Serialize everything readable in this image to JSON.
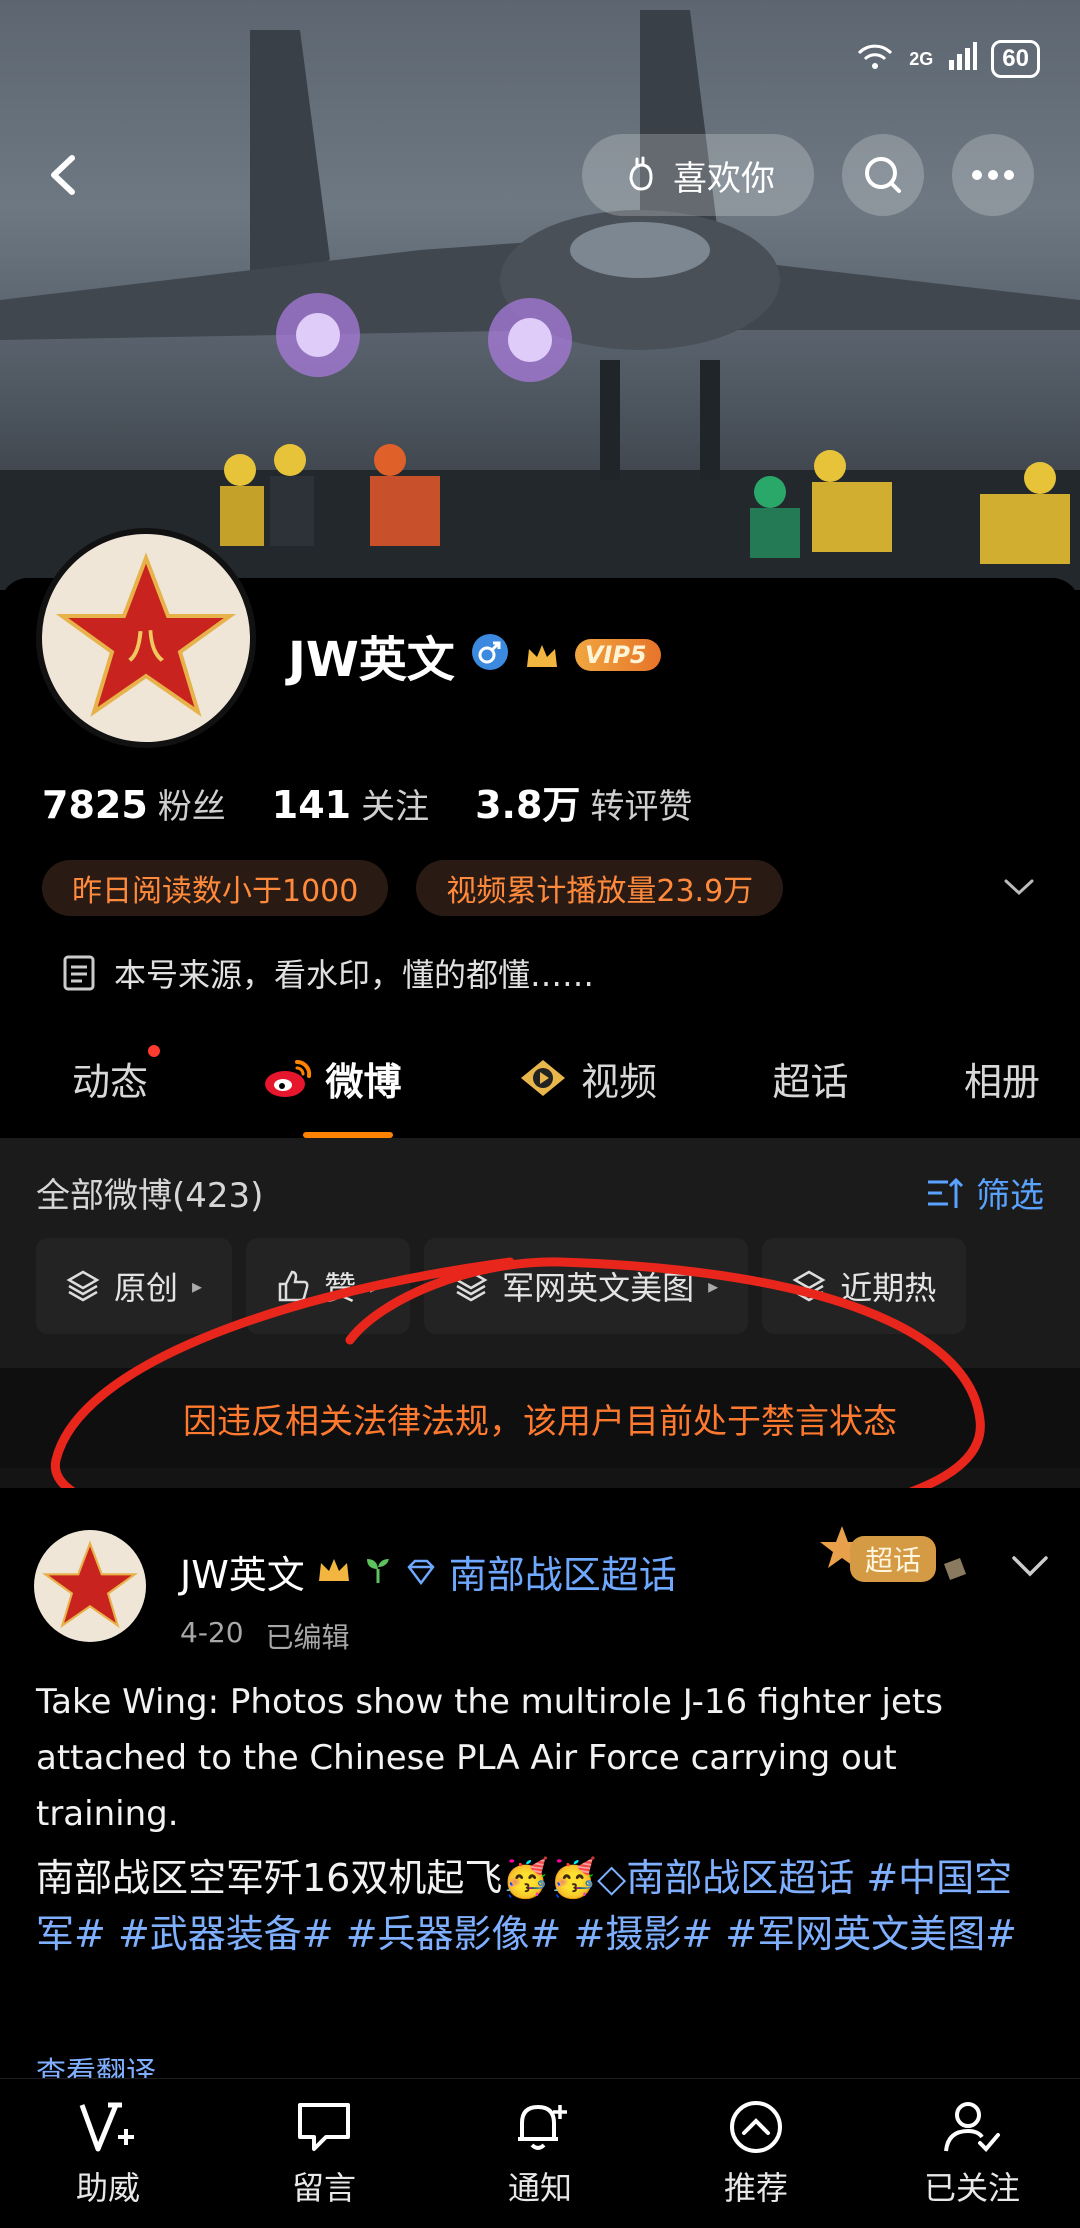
{
  "status_bar": {
    "network": "2G",
    "battery": "60"
  },
  "top_nav": {
    "like_label": "喜欢你"
  },
  "profile": {
    "avatar_char": "八",
    "username": "JW英文",
    "vip_label": "VIP5",
    "stats": [
      {
        "value": "7825",
        "label": "粉丝"
      },
      {
        "value": "141",
        "label": "关注"
      },
      {
        "value": "3.8万",
        "label": "转评赞"
      }
    ],
    "tags": [
      "昨日阅读数小于1000",
      "视频累计播放量23.9万"
    ],
    "bio": "本号来源，看水印，懂的都懂……"
  },
  "tabs": [
    {
      "label": "动态"
    },
    {
      "label": "微博"
    },
    {
      "label": "视频"
    },
    {
      "label": "超话"
    },
    {
      "label": "相册"
    }
  ],
  "feed": {
    "all_posts": "全部微博(423)",
    "filter_label": "筛选",
    "chips": [
      "原创",
      "赞",
      "军网英文美图",
      "近期热"
    ]
  },
  "ban_notice": "因违反相关法律法规，该用户目前处于禁言状态",
  "post": {
    "author": "JW英文",
    "super_topic": "南部战区超话",
    "date": "4-20",
    "edited": "已编辑",
    "badge": "超话",
    "text_en": "Take Wing: Photos show the multirole J-16 fighter jets attached to the Chinese PLA Air Force carrying out training.",
    "text_cn_main": "南部战区空军歼16双机起飞",
    "text_cn_topic": "南部战区超话",
    "hashtags": [
      "#中国空军#",
      "#武器装备#",
      "#兵器影像#",
      "#摄影#",
      "#军网英文美图#"
    ],
    "translate": "查看翻译"
  },
  "bottom_bar": [
    "助威",
    "留言",
    "通知",
    "推荐",
    "已关注"
  ],
  "colors": {
    "accent": "#ff8200",
    "link": "#6ea8ff",
    "warning": "#ff7a2e",
    "annotation": "#e8261c"
  }
}
